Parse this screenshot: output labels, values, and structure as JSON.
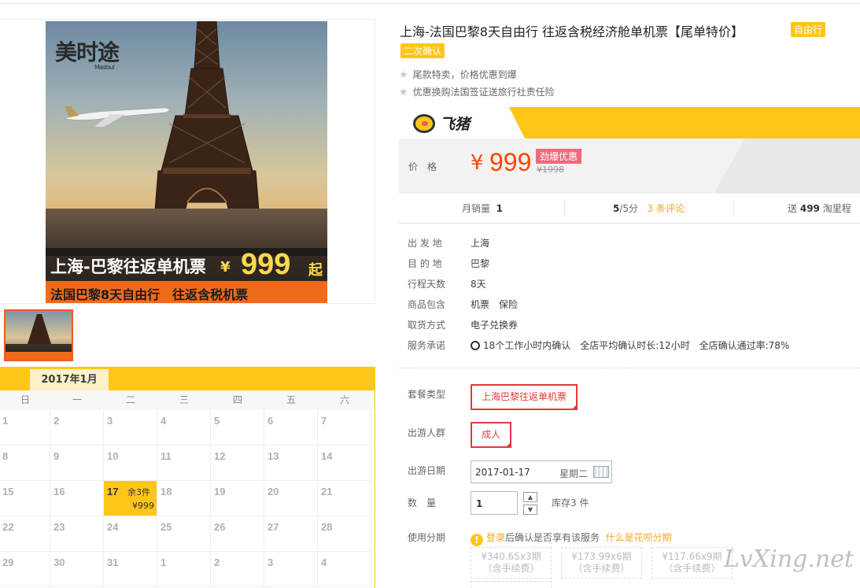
{
  "image": {
    "brand": "美时途",
    "brand_sub": "Mastour",
    "banner_text": "上海-巴黎往返单机票",
    "banner_yen": "¥",
    "banner_price": "999",
    "banner_suffix": "起",
    "banner_sub": "法国巴黎8天自由行　往返含税机票"
  },
  "calendar": {
    "month_label": "2017年1月",
    "weekdays": [
      "日",
      "一",
      "二",
      "三",
      "四",
      "五",
      "六"
    ],
    "rows": [
      [
        "1",
        "2",
        "3",
        "4",
        "5",
        "6",
        "7"
      ],
      [
        "8",
        "9",
        "10",
        "11",
        "12",
        "13",
        "14"
      ],
      [
        "15",
        "16",
        "17",
        "18",
        "19",
        "20",
        "21"
      ],
      [
        "22",
        "23",
        "24",
        "25",
        "26",
        "27",
        "28"
      ],
      [
        "29",
        "30",
        "31",
        "1",
        "2",
        "3",
        "4"
      ]
    ],
    "selected_stock": "余3件",
    "selected_price": "¥999"
  },
  "product": {
    "title": "上海-法国巴黎8天自由行 往返含税经济舱单机票【尾单特价】",
    "tag1": "自由行",
    "tag2": "二次确认",
    "features": [
      "尾款特卖，价格优惠到爆",
      "优惠换购法国签证送旅行社责任险"
    ]
  },
  "price": {
    "platform": "飞猪",
    "label": "价格",
    "yen": "¥",
    "value": "999",
    "promo": "劲爆优惠",
    "original": "¥1998"
  },
  "stats": {
    "sales_label": "月销量",
    "sales_value": "1",
    "score_value": "5",
    "score_suffix": "/5分",
    "reviews": "3 条评论",
    "points_prefix": "送",
    "points_value": "499",
    "points_suffix": "淘里程"
  },
  "props": [
    {
      "k": "出 发 地",
      "v": "上海"
    },
    {
      "k": "目 的 地",
      "v": "巴黎"
    },
    {
      "k": "行程天数",
      "v": "8天"
    },
    {
      "k": "商品包含",
      "v": "机票　保险"
    },
    {
      "k": "取货方式",
      "v": "电子兑换券"
    },
    {
      "k": "服务承诺",
      "v": "18个工作小时内确认　全店平均确认时长:12小时　全店确认通过率:78%"
    }
  ],
  "options": {
    "package_label": "套餐类型",
    "package_value": "上海巴黎往返单机票",
    "group_label": "出游人群",
    "group_value": "成人",
    "date_label": "出游日期",
    "date_value": "2017-01-17",
    "date_weekday": "星期二",
    "qty_label": "数　量",
    "qty_value": "1",
    "stock": "库存3 件",
    "installment_label": "使用分期",
    "inst_login": "登录",
    "inst_text": "后确认是否享有该服务",
    "inst_link": "什么是花呗分期",
    "plans": [
      {
        "amount": "¥340.65x3期",
        "fee": "（含手续费）"
      },
      {
        "amount": "¥173.99x6期",
        "fee": "（含手续费）"
      },
      {
        "amount": "¥117.66x9期",
        "fee": "（含手续费）"
      }
    ]
  },
  "watermark": "LvXing.net"
}
